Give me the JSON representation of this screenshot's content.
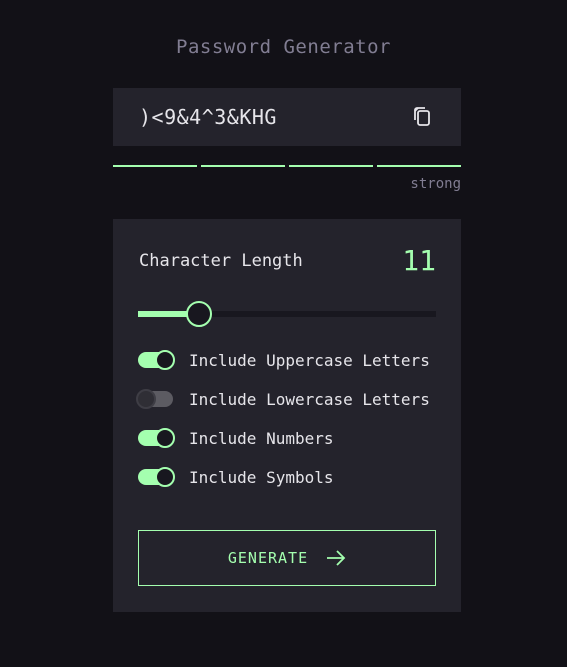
{
  "app": {
    "title": "Password Generator"
  },
  "output": {
    "password": ")<9&4^3&KHG",
    "copy_icon": "copy-icon"
  },
  "strength": {
    "label": "strong",
    "segments_filled": 4,
    "segments_total": 4
  },
  "length": {
    "label": "Character Length",
    "value": "11",
    "min": 6,
    "max": 32
  },
  "options": [
    {
      "label": "Include Uppercase Letters",
      "checked": true
    },
    {
      "label": "Include Lowercase Letters",
      "checked": false
    },
    {
      "label": "Include Numbers",
      "checked": true
    },
    {
      "label": "Include Symbols",
      "checked": true
    }
  ],
  "generate": {
    "label": "GENERATE",
    "icon": "arrow-right-icon"
  },
  "colors": {
    "accent": "#a4ffaf",
    "background": "#121117",
    "panel": "#24232c",
    "muted": "#817d92"
  }
}
